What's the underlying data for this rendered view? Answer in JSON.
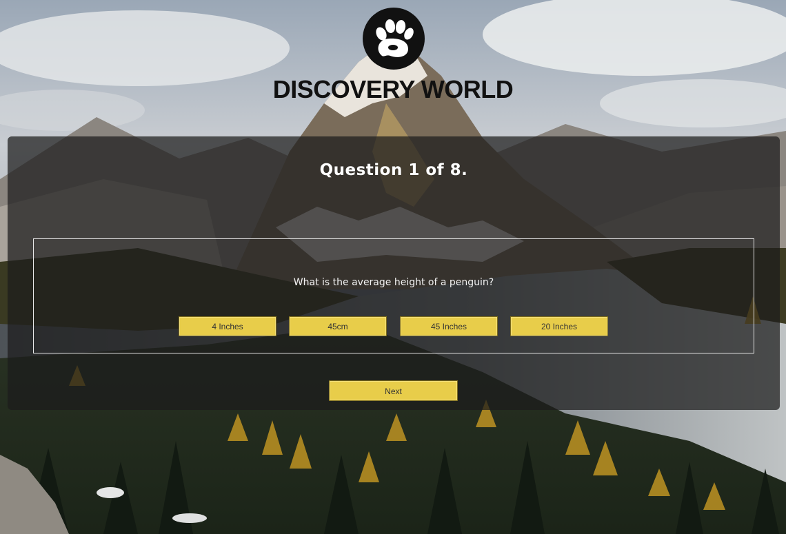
{
  "brand": {
    "name": "DISCOVERY WORLD",
    "logo_icon": "paw-icon"
  },
  "quiz": {
    "heading": "Question 1 of 8.",
    "question": "What is the average height of a penguin?",
    "answers": [
      {
        "label": "4 Inches"
      },
      {
        "label": "45cm"
      },
      {
        "label": "45 Inches"
      },
      {
        "label": "20 Inches"
      }
    ],
    "next_label": "Next"
  },
  "colors": {
    "button_fill": "#e8cd4a",
    "panel_overlay": "rgba(28,28,28,0.72)"
  }
}
